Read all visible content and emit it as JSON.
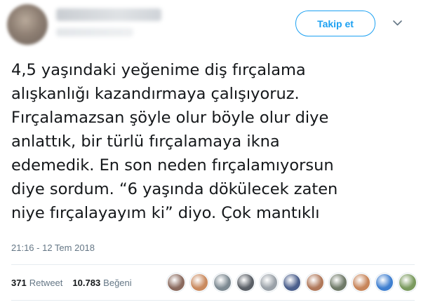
{
  "header": {
    "follow_label": "Takip et",
    "menu_icon": "chevron-down-icon"
  },
  "tweet": {
    "lines": [
      "4,5 yaşındaki yeğenime diş fırçalama",
      "alışkanlığı kazandırmaya çalışıyoruz.",
      "Fırçalamazsan şöyle olur böyle olur diye",
      "anlattık, bir türlü fırçalamaya ikna",
      "edemedik. En son neden fırçalamıyorsun",
      "diye sordum. “6 yaşında dökülecek zaten",
      "niye fırçalayayım ki” diyo. Çok mantıklı"
    ],
    "timestamp": "21:16 - 12 Tem 2018"
  },
  "stats": {
    "retweets_count": "371",
    "retweets_label": "Retweet",
    "likes_count": "10.783",
    "likes_label": "Beğeni"
  },
  "likers": {
    "colors": [
      "#8a6a5e",
      "#c98a5f",
      "#7d8a92",
      "#5a5f66",
      "#9aa1a8",
      "#4b5f8c",
      "#b0785a",
      "#6f7a68",
      "#c7855a",
      "#3f7fd0",
      "#7a9a5e"
    ]
  },
  "colors": {
    "accent": "#1da1f2",
    "text": "#14171a",
    "secondary": "#657786",
    "divider": "#e6ecf0"
  }
}
